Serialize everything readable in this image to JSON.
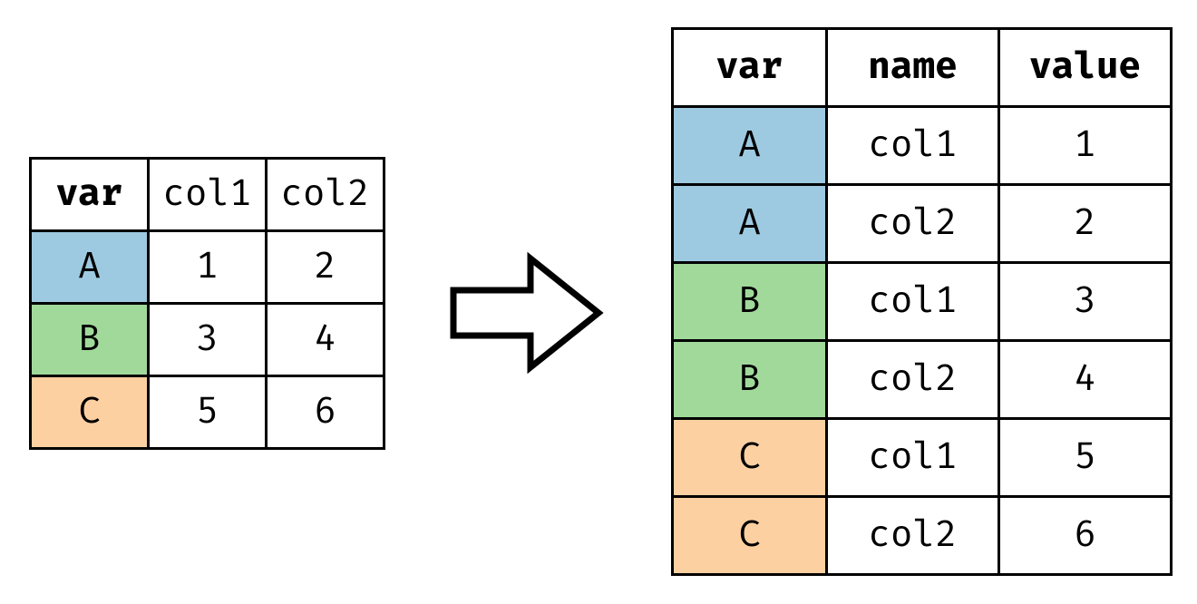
{
  "colors": {
    "blue": "#9ecae1",
    "green": "#a1d99b",
    "orange": "#fdd0a2"
  },
  "wide": {
    "headers": [
      "var",
      "col1",
      "col2"
    ],
    "rows": [
      {
        "var": "A",
        "cells": [
          "1",
          "2"
        ],
        "colorKey": "blue"
      },
      {
        "var": "B",
        "cells": [
          "3",
          "4"
        ],
        "colorKey": "green"
      },
      {
        "var": "C",
        "cells": [
          "5",
          "6"
        ],
        "colorKey": "orange"
      }
    ]
  },
  "long": {
    "headers": [
      "var",
      "name",
      "value"
    ],
    "rows": [
      {
        "var": "A",
        "name": "col1",
        "value": "1",
        "colorKey": "blue"
      },
      {
        "var": "A",
        "name": "col2",
        "value": "2",
        "colorKey": "blue"
      },
      {
        "var": "B",
        "name": "col1",
        "value": "3",
        "colorKey": "green"
      },
      {
        "var": "B",
        "name": "col2",
        "value": "4",
        "colorKey": "green"
      },
      {
        "var": "C",
        "name": "col1",
        "value": "5",
        "colorKey": "orange"
      },
      {
        "var": "C",
        "name": "col2",
        "value": "6",
        "colorKey": "orange"
      }
    ]
  },
  "chart_data": {
    "type": "table",
    "description": "Wide-to-long (melt / pivot_longer) transformation diagram",
    "wide_table": {
      "columns": [
        "var",
        "col1",
        "col2"
      ],
      "data": [
        [
          "A",
          1,
          2
        ],
        [
          "B",
          3,
          4
        ],
        [
          "C",
          5,
          6
        ]
      ]
    },
    "long_table": {
      "columns": [
        "var",
        "name",
        "value"
      ],
      "data": [
        [
          "A",
          "col1",
          1
        ],
        [
          "A",
          "col2",
          2
        ],
        [
          "B",
          "col1",
          3
        ],
        [
          "B",
          "col2",
          4
        ],
        [
          "C",
          "col1",
          5
        ],
        [
          "C",
          "col2",
          6
        ]
      ]
    },
    "row_colors": {
      "A": "#9ecae1",
      "B": "#a1d99b",
      "C": "#fdd0a2"
    }
  }
}
